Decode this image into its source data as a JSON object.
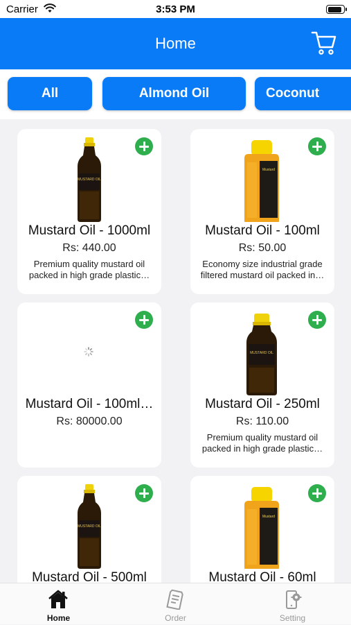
{
  "status_bar": {
    "carrier": "Carrier",
    "time": "3:53 PM",
    "battery_level": 0.95
  },
  "header": {
    "title": "Home",
    "cart_icon": "cart-icon"
  },
  "categories": [
    {
      "label": "All"
    },
    {
      "label": "Almond Oil"
    },
    {
      "label": "Coconut"
    }
  ],
  "products": [
    {
      "name": "Mustard Oil - 1000ml",
      "price": "Rs: 440.00",
      "description": "Premium quality mustard oil packed in high grade plastic…",
      "image": "tall-bottle",
      "add_icon": "plus-circle-icon"
    },
    {
      "name": "Mustard Oil - 100ml",
      "price": "Rs: 50.00",
      "description": "Economy size industrial grade filtered mustard oil packed in…",
      "image": "square-jar",
      "add_icon": "plus-circle-icon"
    },
    {
      "name": "Mustard Oil - 100ml…",
      "price": "Rs: 80000.00",
      "description": "",
      "image": "loading-spinner",
      "add_icon": "plus-circle-icon"
    },
    {
      "name": "Mustard Oil - 250ml",
      "price": "Rs: 110.00",
      "description": "Premium quality mustard oil packed in high grade plastic…",
      "image": "medium-bottle",
      "add_icon": "plus-circle-icon"
    },
    {
      "name": "Mustard Oil - 500ml",
      "price": "",
      "description": "",
      "image": "tall-bottle",
      "add_icon": "plus-circle-icon"
    },
    {
      "name": "Mustard Oil - 60ml",
      "price": "",
      "description": "",
      "image": "square-jar",
      "add_icon": "plus-circle-icon"
    }
  ],
  "tabbar": {
    "tabs": [
      {
        "label": "Home",
        "icon": "home-icon",
        "active": true
      },
      {
        "label": "Order",
        "icon": "order-icon",
        "active": false
      },
      {
        "label": "Setting",
        "icon": "settings-phone-icon",
        "active": false
      }
    ]
  },
  "colors": {
    "primary": "#0a7bf7",
    "add_button": "#2eae4d",
    "background": "#f2f2f4"
  }
}
